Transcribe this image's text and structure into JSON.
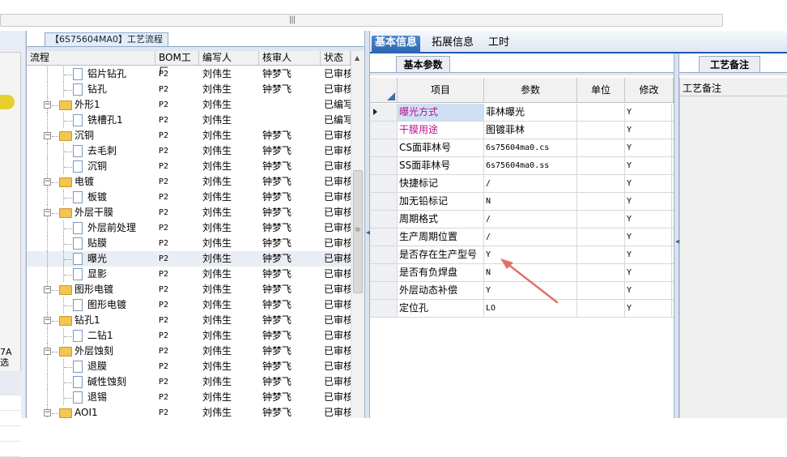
{
  "left_panel": {
    "text_line1": "7A",
    "text_line2": "选"
  },
  "tree": {
    "title": "【6S75604MA0】工艺流程",
    "columns": [
      "流程",
      "BOM工厂",
      "编写人",
      "核审人",
      "状态"
    ],
    "rows": [
      {
        "name": "铝片钻孔",
        "bom": "P2",
        "author": "刘伟生",
        "reviewer": "钟梦飞",
        "status": "已审核",
        "level": 2,
        "type": "doc"
      },
      {
        "name": "钻孔",
        "bom": "P2",
        "author": "刘伟生",
        "reviewer": "钟梦飞",
        "status": "已审核",
        "level": 2,
        "type": "doc"
      },
      {
        "name": "外形1",
        "bom": "P2",
        "author": "刘伟生",
        "reviewer": "",
        "status": "已编写",
        "level": 1,
        "type": "folder"
      },
      {
        "name": "铣槽孔1",
        "bom": "P2",
        "author": "刘伟生",
        "reviewer": "",
        "status": "已编写",
        "level": 2,
        "type": "doc"
      },
      {
        "name": "沉铜",
        "bom": "P2",
        "author": "刘伟生",
        "reviewer": "钟梦飞",
        "status": "已审核",
        "level": 1,
        "type": "folder"
      },
      {
        "name": "去毛刺",
        "bom": "P2",
        "author": "刘伟生",
        "reviewer": "钟梦飞",
        "status": "已审核",
        "level": 2,
        "type": "doc"
      },
      {
        "name": "沉铜",
        "bom": "P2",
        "author": "刘伟生",
        "reviewer": "钟梦飞",
        "status": "已审核",
        "level": 2,
        "type": "doc"
      },
      {
        "name": "电镀",
        "bom": "P2",
        "author": "刘伟生",
        "reviewer": "钟梦飞",
        "status": "已审核",
        "level": 1,
        "type": "folder"
      },
      {
        "name": "板镀",
        "bom": "P2",
        "author": "刘伟生",
        "reviewer": "钟梦飞",
        "status": "已审核",
        "level": 2,
        "type": "doc"
      },
      {
        "name": "外层干膜",
        "bom": "P2",
        "author": "刘伟生",
        "reviewer": "钟梦飞",
        "status": "已审核",
        "level": 1,
        "type": "folder"
      },
      {
        "name": "外层前处理",
        "bom": "P2",
        "author": "刘伟生",
        "reviewer": "钟梦飞",
        "status": "已审核",
        "level": 2,
        "type": "doc"
      },
      {
        "name": "贴膜",
        "bom": "P2",
        "author": "刘伟生",
        "reviewer": "钟梦飞",
        "status": "已审核",
        "level": 2,
        "type": "doc"
      },
      {
        "name": "曝光",
        "bom": "P2",
        "author": "刘伟生",
        "reviewer": "钟梦飞",
        "status": "已审核",
        "level": 2,
        "type": "doc",
        "selected": true
      },
      {
        "name": "显影",
        "bom": "P2",
        "author": "刘伟生",
        "reviewer": "钟梦飞",
        "status": "已审核",
        "level": 2,
        "type": "doc"
      },
      {
        "name": "图形电镀",
        "bom": "P2",
        "author": "刘伟生",
        "reviewer": "钟梦飞",
        "status": "已审核",
        "level": 1,
        "type": "folder"
      },
      {
        "name": "图形电镀",
        "bom": "P2",
        "author": "刘伟生",
        "reviewer": "钟梦飞",
        "status": "已审核",
        "level": 2,
        "type": "doc"
      },
      {
        "name": "钻孔1",
        "bom": "P2",
        "author": "刘伟生",
        "reviewer": "钟梦飞",
        "status": "已审核",
        "level": 1,
        "type": "folder"
      },
      {
        "name": "二钻1",
        "bom": "P2",
        "author": "刘伟生",
        "reviewer": "钟梦飞",
        "status": "已审核",
        "level": 2,
        "type": "doc"
      },
      {
        "name": "外层蚀刻",
        "bom": "P2",
        "author": "刘伟生",
        "reviewer": "钟梦飞",
        "status": "已审核",
        "level": 1,
        "type": "folder"
      },
      {
        "name": "退膜",
        "bom": "P2",
        "author": "刘伟生",
        "reviewer": "钟梦飞",
        "status": "已审核",
        "level": 2,
        "type": "doc"
      },
      {
        "name": "碱性蚀刻",
        "bom": "P2",
        "author": "刘伟生",
        "reviewer": "钟梦飞",
        "status": "已审核",
        "level": 2,
        "type": "doc"
      },
      {
        "name": "退锡",
        "bom": "P2",
        "author": "刘伟生",
        "reviewer": "钟梦飞",
        "status": "已审核",
        "level": 2,
        "type": "doc"
      },
      {
        "name": "AOI1",
        "bom": "P2",
        "author": "刘伟生",
        "reviewer": "钟梦飞",
        "status": "已审核",
        "level": 1,
        "type": "folder"
      }
    ]
  },
  "main_tabs": [
    "基本信息",
    "拓展信息",
    "工时"
  ],
  "sub_tab": "基本参数",
  "params": {
    "columns": [
      "项目",
      "参数",
      "单位",
      "修改"
    ],
    "rows": [
      {
        "item": "曝光方式",
        "value": "菲林曝光",
        "unit": "",
        "mod": "Y",
        "highlight": "magenta",
        "current": true,
        "cn": true
      },
      {
        "item": "干膜用途",
        "value": "图镀菲林",
        "unit": "",
        "mod": "Y",
        "highlight": "magenta",
        "cn": true
      },
      {
        "item": "CS面菲林号",
        "value": "6s75604ma0.cs",
        "unit": "",
        "mod": "Y"
      },
      {
        "item": "SS面菲林号",
        "value": "6s75604ma0.ss",
        "unit": "",
        "mod": "Y"
      },
      {
        "item": "快捷标记",
        "value": "/",
        "unit": "",
        "mod": "Y"
      },
      {
        "item": "加无铅标记",
        "value": "N",
        "unit": "",
        "mod": "Y"
      },
      {
        "item": "周期格式",
        "value": "/",
        "unit": "",
        "mod": "Y"
      },
      {
        "item": "生产周期位置",
        "value": "/",
        "unit": "",
        "mod": "Y"
      },
      {
        "item": "是否存在生产型号",
        "value": "Y",
        "unit": "",
        "mod": "Y"
      },
      {
        "item": "是否有负焊盘",
        "value": "N",
        "unit": "",
        "mod": "Y"
      },
      {
        "item": "外层动态补偿",
        "value": "Y",
        "unit": "",
        "mod": "Y"
      },
      {
        "item": "定位孔",
        "value": "LO",
        "unit": "",
        "mod": "Y"
      }
    ]
  },
  "notes": {
    "tab": "工艺备注",
    "label": "工艺备注"
  },
  "colors": {
    "accent": "#2a64b2",
    "magenta": "#c0108a",
    "annotation": "#e0706a"
  }
}
